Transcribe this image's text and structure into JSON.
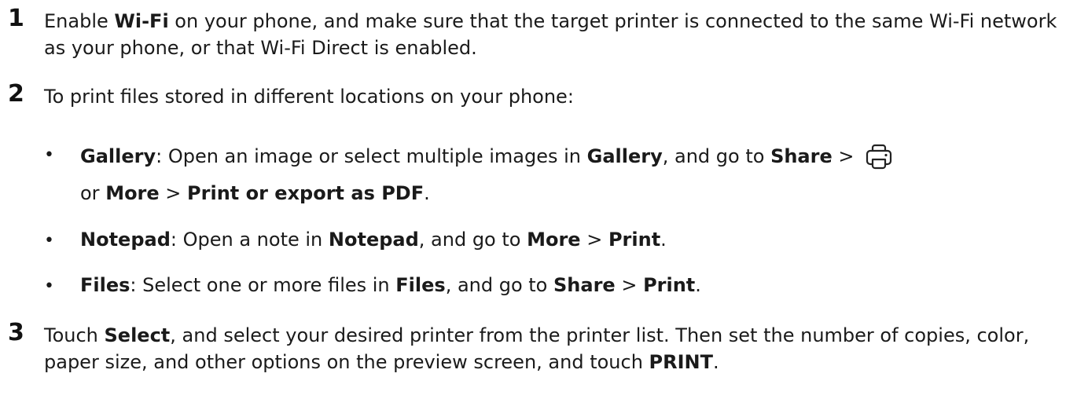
{
  "steps": [
    {
      "number": "1",
      "parts": [
        {
          "t": "Enable "
        },
        {
          "t": "Wi-Fi",
          "b": true
        },
        {
          "t": " on your phone, and make sure that the target printer is connected to the same Wi-Fi network as your phone, or that Wi-Fi Direct is enabled."
        }
      ]
    },
    {
      "number": "2",
      "parts": [
        {
          "t": "To print files stored in different locations on your phone:"
        }
      ]
    },
    {
      "number": "3",
      "parts": [
        {
          "t": "Touch "
        },
        {
          "t": "Select",
          "b": true
        },
        {
          "t": ", and select your desired printer from the printer list. Then set the number of copies, color, paper size, and other options on the preview screen, and touch "
        },
        {
          "t": "PRINT",
          "b": true
        },
        {
          "t": "."
        }
      ]
    }
  ],
  "bullets": [
    {
      "bullet": "•",
      "parts": [
        {
          "t": "Gallery",
          "b": true
        },
        {
          "t": ": Open an image or select multiple images in "
        },
        {
          "t": "Gallery",
          "b": true
        },
        {
          "t": ", and go to "
        },
        {
          "t": "Share",
          "b": true
        },
        {
          "t": " > "
        },
        {
          "icon": "printer-icon"
        },
        {
          "br": true
        },
        {
          "t": "or "
        },
        {
          "t": "More",
          "b": true
        },
        {
          "t": " > "
        },
        {
          "t": "Print or export as PDF",
          "b": true
        },
        {
          "t": "."
        }
      ]
    },
    {
      "bullet": "•",
      "parts": [
        {
          "t": "Notepad",
          "b": true
        },
        {
          "t": ": Open a note in "
        },
        {
          "t": "Notepad",
          "b": true
        },
        {
          "t": ", and go to "
        },
        {
          "t": "More",
          "b": true
        },
        {
          "t": " > "
        },
        {
          "t": "Print",
          "b": true
        },
        {
          "t": "."
        }
      ]
    },
    {
      "bullet": "•",
      "parts": [
        {
          "t": "Files",
          "b": true
        },
        {
          "t": ": Select one or more files in "
        },
        {
          "t": "Files",
          "b": true
        },
        {
          "t": ", and go to "
        },
        {
          "t": "Share",
          "b": true
        },
        {
          "t": " > "
        },
        {
          "t": "Print",
          "b": true
        },
        {
          "t": "."
        }
      ]
    }
  ]
}
